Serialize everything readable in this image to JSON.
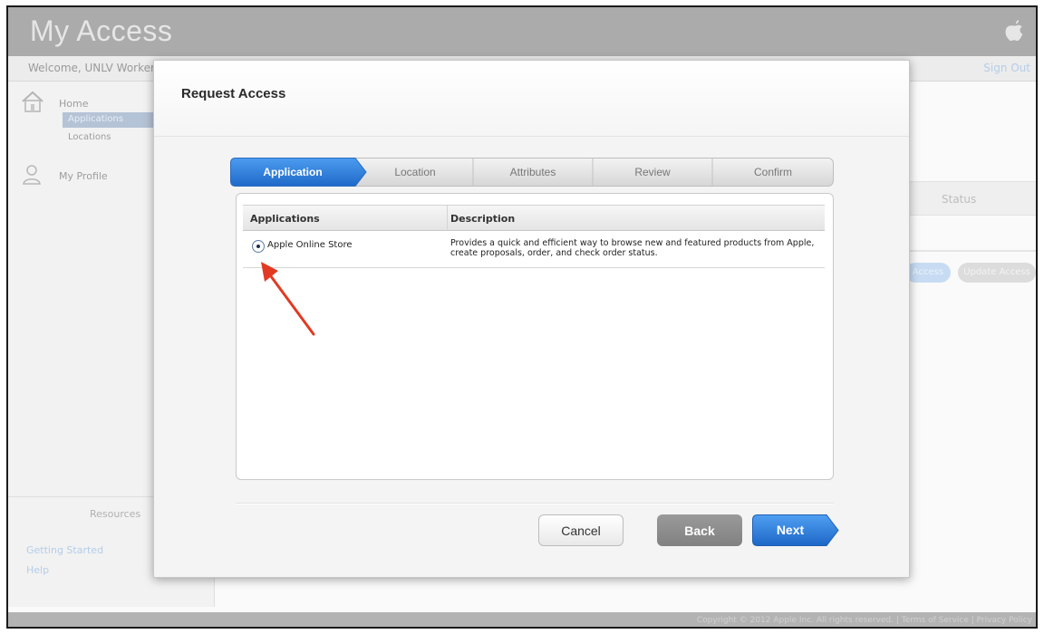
{
  "app": {
    "title": "My Access",
    "welcome": "Welcome, UNLV Worker |",
    "sign_out": "Sign Out",
    "footer": "Copyright © 2012 Apple Inc. All rights reserved.  |  Terms of Service  |  Privacy Policy"
  },
  "sidebar": {
    "home": "Home",
    "applications": "Applications",
    "locations": "Locations",
    "profile": "My Profile",
    "resources_title": "Resources",
    "getting_started": "Getting Started",
    "help": "Help"
  },
  "background": {
    "status_header": "Status",
    "access_button": "Access",
    "update_access_button": "Update Access"
  },
  "modal": {
    "title": "Request Access",
    "steps": [
      "Application",
      "Location",
      "Attributes",
      "Review",
      "Confirm"
    ],
    "active_step": 0,
    "table": {
      "columns": [
        "Applications",
        "Description"
      ],
      "rows": [
        {
          "name": "Apple Online Store",
          "selected": true,
          "description": "Provides a quick and efficient way to browse new and featured products from Apple, create proposals, order, and check order status."
        }
      ]
    },
    "buttons": {
      "cancel": "Cancel",
      "back": "Back",
      "next": "Next"
    }
  },
  "colors": {
    "accent": "#2f7fd6",
    "annotation": "#e23a22",
    "back_button": "#888888"
  }
}
